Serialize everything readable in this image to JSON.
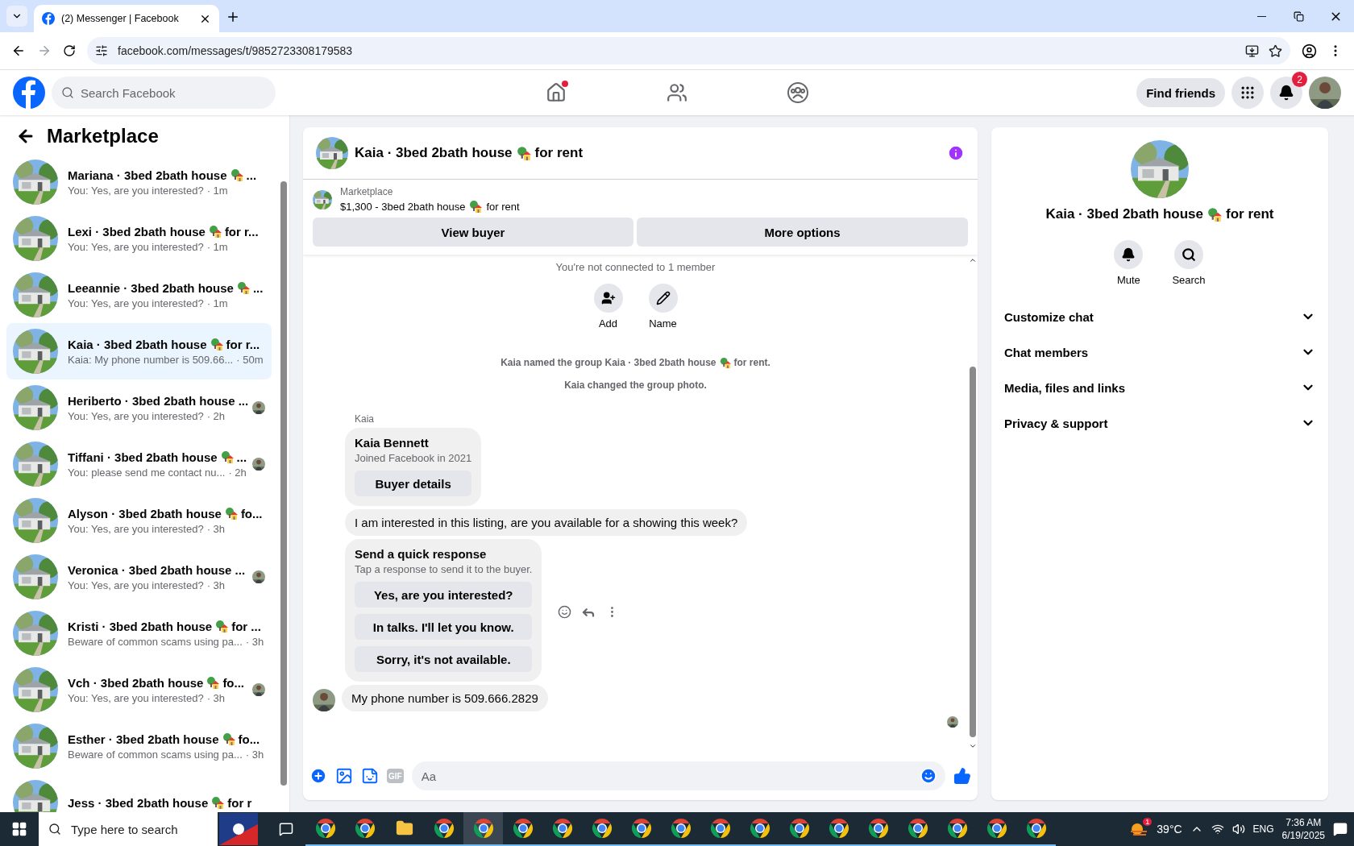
{
  "browser": {
    "tab_title": "(2) Messenger | Facebook",
    "url": "facebook.com/messages/t/9852723308179583"
  },
  "header": {
    "search_placeholder": "Search Facebook",
    "find_friends": "Find friends",
    "notification_count": "2"
  },
  "sidebar": {
    "title": "Marketplace",
    "conversations": [
      {
        "title": "Mariana · 3bed 2bath house",
        "house_icon": true,
        "tail": "...",
        "preview": "You: Yes, are you interested?",
        "time": "· 1m",
        "selected": false,
        "seen_avatar": false
      },
      {
        "title": "Lexi · 3bed 2bath house",
        "house_icon": true,
        "tail": "for r...",
        "preview": "You: Yes, are you interested?",
        "time": "· 1m",
        "selected": false,
        "seen_avatar": false
      },
      {
        "title": "Leeannie · 3bed 2bath house",
        "house_icon": true,
        "tail": "...",
        "preview": "You: Yes, are you interested?",
        "time": "· 1m",
        "selected": false,
        "seen_avatar": false
      },
      {
        "title": "Kaia · 3bed 2bath house",
        "house_icon": true,
        "tail": "for r...",
        "preview": "Kaia: My phone number is 509.66...",
        "time": "· 50m",
        "selected": true,
        "seen_avatar": false
      },
      {
        "title": "Heriberto · 3bed 2bath house ...",
        "house_icon": false,
        "preview": "You: Yes, are you interested?",
        "time": "· 2h",
        "selected": false,
        "seen_avatar": true
      },
      {
        "title": "Tiffani · 3bed 2bath house",
        "house_icon": true,
        "tail": "...",
        "preview": "You: please send me contact nu...",
        "time": "· 2h",
        "selected": false,
        "seen_avatar": true
      },
      {
        "title": "Alyson · 3bed 2bath house",
        "house_icon": true,
        "tail": "fo...",
        "preview": "You: Yes, are you interested?",
        "time": "· 3h",
        "selected": false,
        "seen_avatar": false
      },
      {
        "title": "Veronica · 3bed 2bath house ...",
        "house_icon": false,
        "preview": "You: Yes, are you interested?",
        "time": "· 3h",
        "selected": false,
        "seen_avatar": true
      },
      {
        "title": "Kristi · 3bed 2bath house",
        "house_icon": true,
        "tail": "for ...",
        "preview": "Beware of common scams using pa...",
        "time": "· 3h",
        "selected": false,
        "seen_avatar": false
      },
      {
        "title": "Vch · 3bed 2bath house",
        "house_icon": true,
        "tail": "fo...",
        "preview": "You: Yes, are you interested?",
        "time": "· 3h",
        "selected": false,
        "seen_avatar": true
      },
      {
        "title": "Esther · 3bed 2bath house",
        "house_icon": true,
        "tail": "fo...",
        "preview": "Beware of common scams using pa...",
        "time": "· 3h",
        "selected": false,
        "seen_avatar": false
      },
      {
        "title": "Jess · 3bed 2bath house",
        "house_icon": true,
        "tail": "for r",
        "selected": false
      }
    ]
  },
  "chat": {
    "title": "Kaia · 3bed 2bath house",
    "title_tail": "for rent",
    "listing": {
      "label": "Marketplace",
      "price_title": "$1,300 - 3bed 2bath house",
      "tail": "for rent"
    },
    "actions": [
      "View buyer",
      "More options"
    ],
    "connection_note": "You're not connected to 1 member",
    "group_actions": [
      {
        "kind": "add",
        "label": "Add"
      },
      {
        "kind": "name",
        "label": "Name"
      }
    ],
    "system_messages": [
      {
        "text": "Kaia named the group Kaia · 3bed 2bath house",
        "tail": "for rent.",
        "house_icon": true
      },
      {
        "text": "Kaia changed the group photo.",
        "house_icon": false
      }
    ],
    "sender": "Kaia",
    "buyer_card": {
      "name": "Kaia Bennett",
      "joined": "Joined Facebook in 2021",
      "button": "Buyer details"
    },
    "message": "I am interested in this listing, are you available for a showing this week?",
    "quick_response": {
      "title": "Send a quick response",
      "hint": "Tap a response to send it to the buyer.",
      "options": [
        "Yes, are you interested?",
        "In talks. I'll let you know.",
        "Sorry, it's not available."
      ]
    },
    "last_message": "My phone number is 509.666.2829",
    "composer": {
      "gif_label": "GIF",
      "placeholder": "Aa"
    }
  },
  "info_panel": {
    "title": "Kaia · 3bed 2bath house",
    "title_tail": "for rent",
    "actions": [
      {
        "kind": "mute",
        "label": "Mute"
      },
      {
        "kind": "search",
        "label": "Search"
      }
    ],
    "sections": [
      {
        "label": "Customize chat",
        "expanded": false
      },
      {
        "label": "Chat members",
        "expanded": false
      },
      {
        "label": "Media, files and links",
        "expanded": false
      },
      {
        "label": "Privacy & support",
        "expanded": false
      }
    ]
  },
  "taskbar": {
    "search_placeholder": "Type here to search",
    "weather_badge": "1",
    "temperature": "39°C",
    "language": "ENG",
    "time": "7:36 AM",
    "date": "6/19/2025"
  }
}
